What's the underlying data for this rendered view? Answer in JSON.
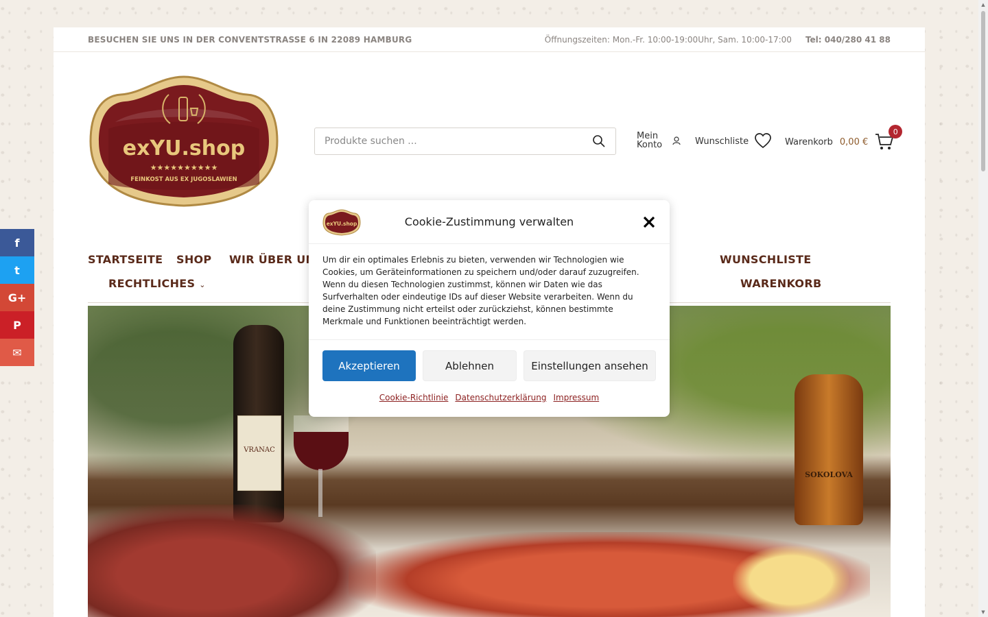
{
  "topbar": {
    "address": "BESUCHEN SIE UNS IN DER  CONVENTSTRASSE 6 IN 22089 HAMBURG",
    "hours": "Öffnungszeiten: Mon.-Fr. 10:00-19:00Uhr, Sam. 10:00-17:00",
    "phone": "Tel: 040/280 41 88"
  },
  "logo": {
    "name": "exYU.shop",
    "tagline": "FEINKOST AUS EX JUGOSLAWIEN",
    "stars": "★★★★★★★★★★",
    "colors": {
      "burgundy": "#7a1a1e",
      "gold": "#d8b46a"
    }
  },
  "search": {
    "placeholder": "Produkte suchen ..."
  },
  "header": {
    "account_line1": "Mein",
    "account_line2": "Konto",
    "wishlist_label": "Wunschliste",
    "cart_label": "Warenkorb",
    "cart_total": "0,00 €",
    "cart_count": "0"
  },
  "nav": {
    "startseite": "STARTSEITE",
    "shop": "SHOP",
    "about": "WIR ÜBER UNS",
    "legal": "RECHTLICHES",
    "wishlist": "WUNSCHLISTE",
    "cart": "WARENKORB"
  },
  "hero": {
    "bottle_label": "VRANAC",
    "brandy_label": "SOKOLOVA"
  },
  "social": [
    "f",
    "t",
    "G+",
    "P",
    "✉"
  ],
  "cookie": {
    "title": "Cookie-Zustimmung verwalten",
    "body": "Um dir ein optimales Erlebnis zu bieten, verwenden wir Technologien wie Cookies, um Geräteinformationen zu speichern und/oder darauf zuzugreifen. Wenn du diesen Technologien zustimmst, können wir Daten wie das Surfverhalten oder eindeutige IDs auf dieser Website verarbeiten. Wenn du deine Zustimmung nicht erteilst oder zurückziehst, können bestimmte Merkmale und Funktionen beeinträchtigt werden.",
    "accept": "Akzeptieren",
    "deny": "Ablehnen",
    "settings": "Einstellungen ansehen",
    "link_policy": "Cookie-Richtlinie",
    "link_privacy": "Datenschutzerklärung",
    "link_imprint": "Impressum",
    "accent": "#1e73be"
  }
}
